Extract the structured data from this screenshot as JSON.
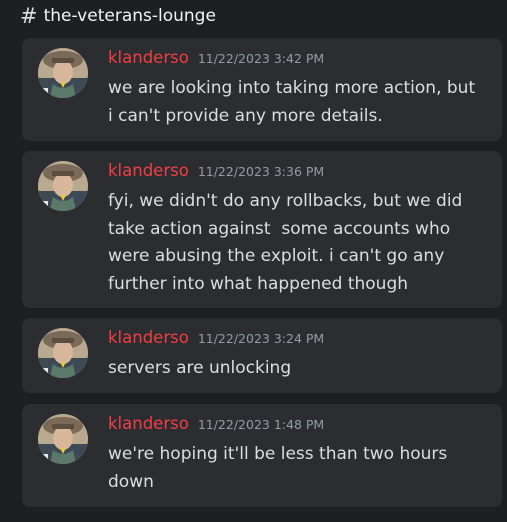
{
  "channel": {
    "name": "the-veterans-lounge",
    "icon": "hash-icon"
  },
  "messages": [
    {
      "username": "klanderso",
      "timestamp": "11/22/2023 3:42 PM",
      "lines": [
        "we are looking into taking more action, but",
        "i can't provide any more details."
      ]
    },
    {
      "username": "klanderso",
      "timestamp": "11/22/2023 3:36 PM",
      "lines": [
        "fyi, we didn't do any rollbacks, but we did",
        "take action against  some accounts who",
        "were abusing the exploit. i can't go any",
        "further into what happened though"
      ]
    },
    {
      "username": "klanderso",
      "timestamp": "11/22/2023 3:24 PM",
      "lines": [
        "servers are unlocking"
      ]
    },
    {
      "username": "klanderso",
      "timestamp": "11/22/2023 1:48 PM",
      "lines": [
        "we're hoping it'll be less than two hours",
        "down"
      ]
    }
  ],
  "colors": {
    "background": "#1e1f22",
    "card": "#2b2d31",
    "username": "#f23f42",
    "timestamp": "#949ba4",
    "text": "#dbdee1"
  }
}
